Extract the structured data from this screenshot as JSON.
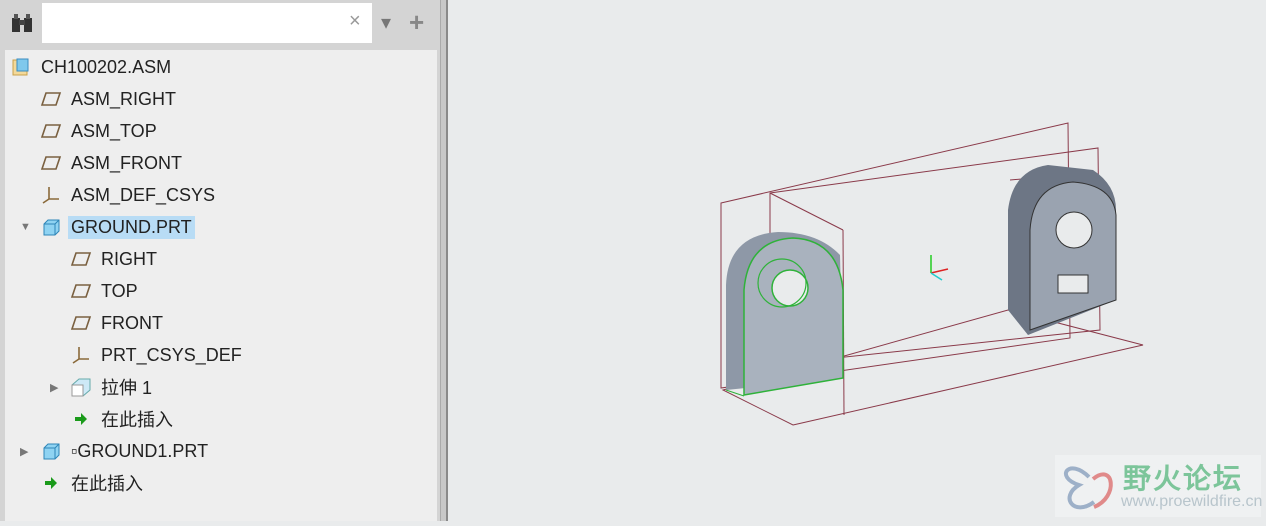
{
  "search": {
    "value": "",
    "clear_icon": "×",
    "dropdown_icon": "▾",
    "add_icon": "+"
  },
  "tree": [
    {
      "label": "CH100202.ASM",
      "icon": "assembly-icon",
      "level": 0
    },
    {
      "label": "ASM_RIGHT",
      "icon": "datum-plane-icon",
      "level": 1
    },
    {
      "label": "ASM_TOP",
      "icon": "datum-plane-icon",
      "level": 1
    },
    {
      "label": "ASM_FRONT",
      "icon": "datum-plane-icon",
      "level": 1
    },
    {
      "label": "ASM_DEF_CSYS",
      "icon": "csys-icon",
      "level": 1
    },
    {
      "label": "GROUND.PRT",
      "icon": "part-icon",
      "level": 1,
      "expanded": true,
      "selected": true
    },
    {
      "label": "RIGHT",
      "icon": "datum-plane-icon",
      "level": 2
    },
    {
      "label": "TOP",
      "icon": "datum-plane-icon",
      "level": 2
    },
    {
      "label": "FRONT",
      "icon": "datum-plane-icon",
      "level": 2
    },
    {
      "label": "PRT_CSYS_DEF",
      "icon": "csys-icon",
      "level": 2
    },
    {
      "label": "拉伸 1",
      "icon": "extrude-icon",
      "level": 2,
      "collapsed": true
    },
    {
      "label": "在此插入",
      "icon": "insert-here-icon",
      "level": 2
    },
    {
      "label": "▫GROUND1.PRT",
      "icon": "part-icon",
      "level": 1,
      "collapsed": true
    },
    {
      "label": "在此插入",
      "icon": "insert-here-icon",
      "level": 1
    }
  ],
  "watermark": {
    "title": "野火论坛",
    "url": "www.proewildfire.cn"
  }
}
